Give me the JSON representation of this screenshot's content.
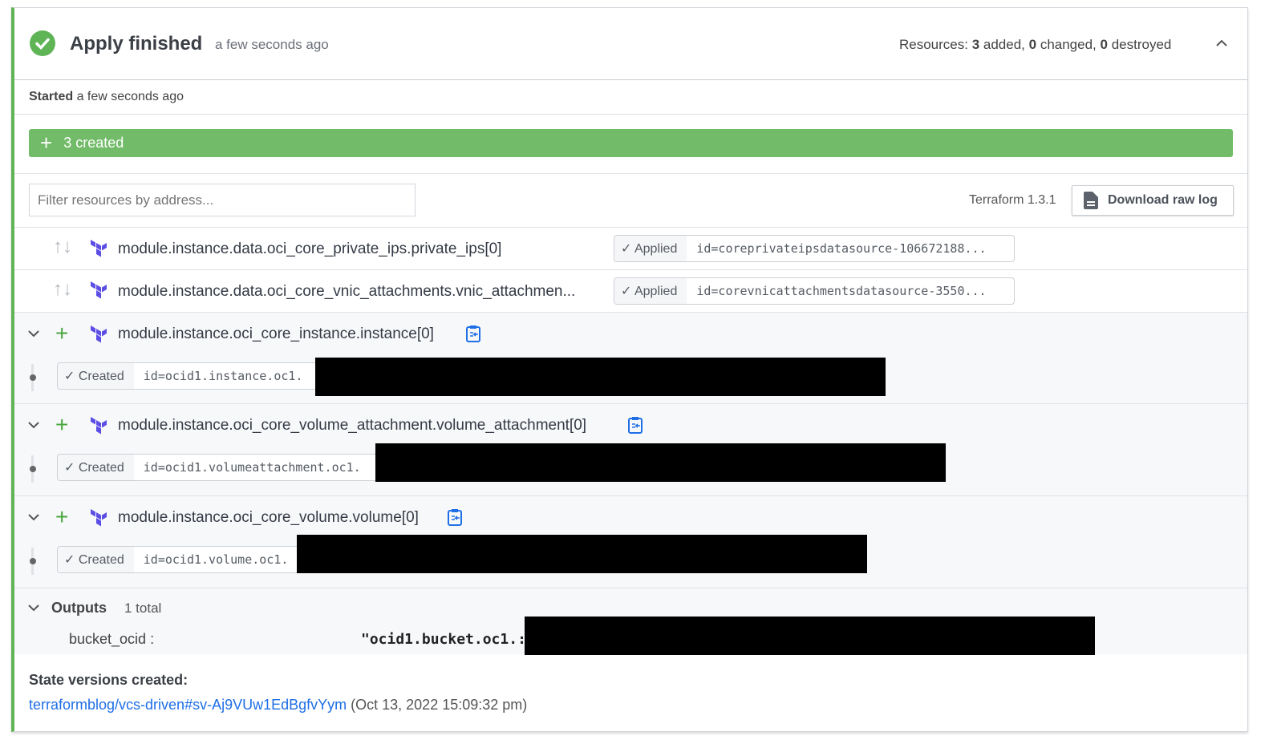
{
  "header": {
    "title": "Apply finished",
    "time": "a few seconds ago",
    "resources_prefix": "Resources: ",
    "added": "3",
    "added_label": " added, ",
    "changed": "0",
    "changed_label": " changed, ",
    "destroyed": "0",
    "destroyed_label": " destroyed"
  },
  "started": {
    "label": "Started",
    "time": " a few seconds ago"
  },
  "summary": {
    "label": "3 created",
    "color": "#72bb68"
  },
  "filter": {
    "placeholder": "Filter resources by address..."
  },
  "terraform_version": "Terraform 1.3.1",
  "download_label": "Download raw log",
  "data_rows": [
    {
      "name": "module.instance.data.oci_core_private_ips.private_ips[0]",
      "status": "✓ Applied",
      "id": "id=coreprivateipsdatasource-106672188..."
    },
    {
      "name": "module.instance.data.oci_core_vnic_attachments.vnic_attachmen...",
      "status": "✓ Applied",
      "id": "id=corevnicattachmentsdatasource-3550..."
    }
  ],
  "created_rows": [
    {
      "name": "module.instance.oci_core_instance.instance[0]",
      "status": "✓ Created",
      "id": "id=ocid1.instance.oc1."
    },
    {
      "name": "module.instance.oci_core_volume_attachment.volume_attachment[0]",
      "status": "✓ Created",
      "id": "id=ocid1.volumeattachment.oc1."
    },
    {
      "name": "module.instance.oci_core_volume.volume[0]",
      "status": "✓ Created",
      "id": "id=ocid1.volume.oc1."
    }
  ],
  "outputs": {
    "label": "Outputs",
    "count": "1 total",
    "key": "bucket_ocid :",
    "value": "\"ocid1.bucket.oc1.:"
  },
  "state": {
    "title": "State versions created:",
    "link": "terraformblog/vcs-driven#sv-Aj9VUw1EdBgfvYym",
    "date": " (Oct 13, 2022 15:09:32 pm)"
  }
}
